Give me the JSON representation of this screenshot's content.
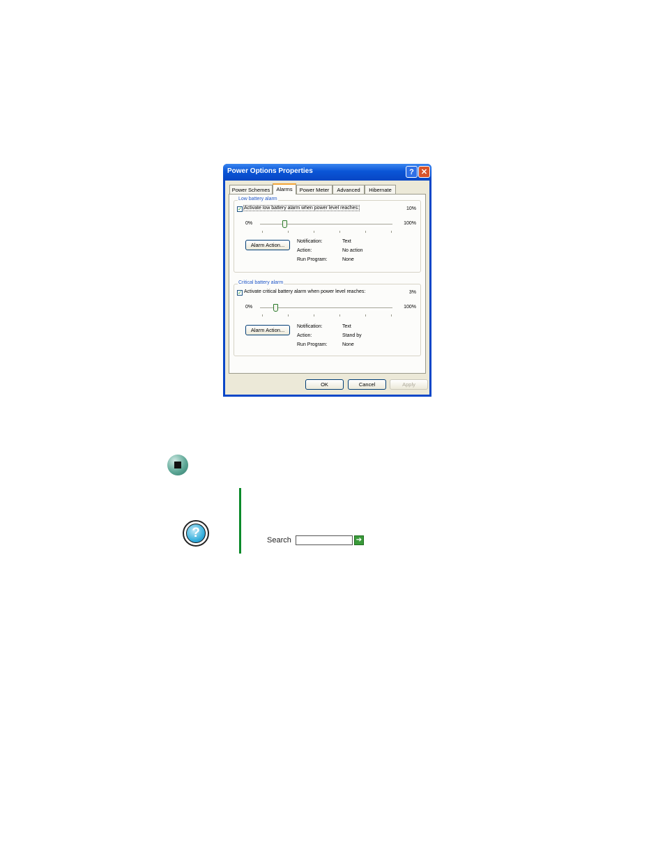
{
  "dialog": {
    "title": "Power Options Properties",
    "help_glyph": "?",
    "close_glyph": "✕",
    "tabs": [
      {
        "label": "Power Schemes"
      },
      {
        "label": "Alarms"
      },
      {
        "label": "Power Meter"
      },
      {
        "label": "Advanced"
      },
      {
        "label": "Hibernate"
      }
    ],
    "active_tab": "Alarms",
    "low": {
      "group_label": "Low battery alarm",
      "checkbox_label": "Activate low battery alarm when power level reaches:",
      "checked": true,
      "check_glyph": "✓",
      "percent": "10%",
      "slider_min": "0%",
      "slider_max": "100%",
      "slider_level": 0.1,
      "button": "Alarm Action...",
      "notification_label": "Notification:",
      "notification_value": "Text",
      "action_label": "Action:",
      "action_value": "No action",
      "run_label": "Run Program:",
      "run_value": "None"
    },
    "critical": {
      "group_label": "Critical battery alarm",
      "checkbox_label": "Activate critical battery alarm when power level reaches:",
      "checked": true,
      "check_glyph": "✓",
      "percent": "3%",
      "slider_min": "0%",
      "slider_max": "100%",
      "slider_level": 0.03,
      "button": "Alarm Action...",
      "notification_label": "Notification:",
      "notification_value": "Text",
      "action_label": "Action:",
      "action_value": "Stand by",
      "run_label": "Run Program:",
      "run_value": "None"
    },
    "buttons": {
      "ok": "OK",
      "cancel": "Cancel",
      "apply": "Apply"
    }
  },
  "page": {
    "search_label": "Search",
    "search_value": "",
    "go_glyph": "➔",
    "help_glyph": "?",
    "accent": "#0a8a2a"
  }
}
